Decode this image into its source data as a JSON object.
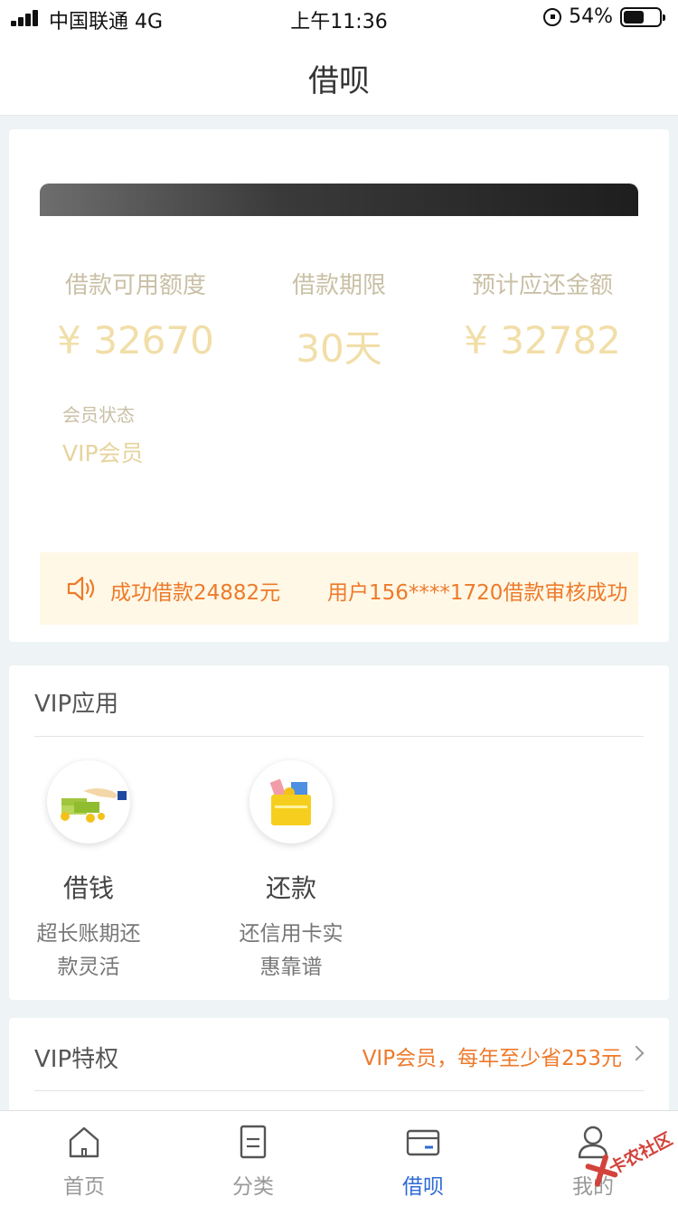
{
  "status_bar": {
    "carrier": "中国联通 4G",
    "time": "上午11:36",
    "battery": "54%"
  },
  "nav": {
    "title": "借呗"
  },
  "loan": {
    "available_label": "借款可用额度",
    "available_value": "¥ 32670",
    "term_label": "借款期限",
    "term_value": "30天",
    "repay_label": "预计应还金额",
    "repay_value": "¥ 32782",
    "member_label": "会员状态",
    "member_value": "VIP会员"
  },
  "notice": {
    "messages": [
      "成功借款24882元",
      "用户156****1720借款审核成功"
    ]
  },
  "vip_apps": {
    "title": "VIP应用",
    "items": [
      {
        "name": "借钱",
        "desc_line1": "超长账期还",
        "desc_line2": "款灵活"
      },
      {
        "name": "还款",
        "desc_line1": "还信用卡实",
        "desc_line2": "惠靠谱"
      }
    ]
  },
  "vip_privilege": {
    "title": "VIP特权",
    "promo": "VIP会员，每年至少省253元"
  },
  "tabbar": {
    "items": [
      {
        "label": "首页",
        "icon": "home-icon"
      },
      {
        "label": "分类",
        "icon": "list-icon"
      },
      {
        "label": "借呗",
        "icon": "card-icon"
      },
      {
        "label": "我的",
        "icon": "user-icon"
      }
    ],
    "active_color": "#2e6bd6"
  },
  "watermark": {
    "text": "卡农社区"
  }
}
